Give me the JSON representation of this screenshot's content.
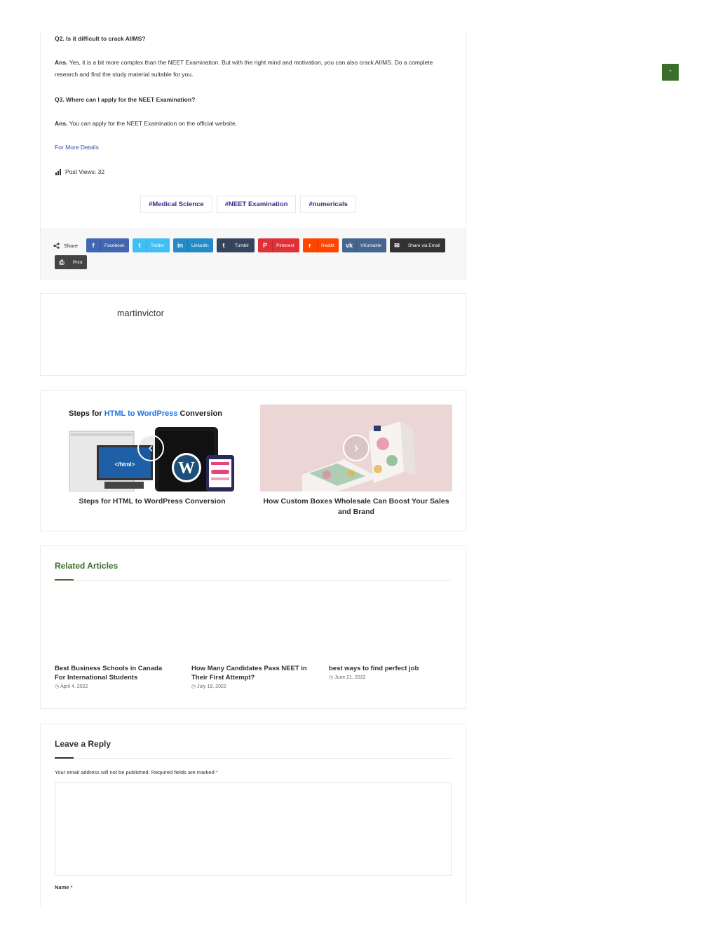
{
  "faq": [
    {
      "question": "Q2. Is it difficult to crack AIIMS?",
      "answer_label": "Ans.",
      "answer": " Yes, it is a bit more complex than the NEET Examination. But with the right mind and motivation, you can also crack AIIMS. Do a complete research and find the study material suitable for you."
    },
    {
      "question": "Q3. Where can I apply for the NEET Examination?",
      "answer_label": "Ans.",
      "answer": " You can apply for the NEET Examination on the official website."
    }
  ],
  "more_link": "For More Details",
  "post_views": "Post Views: 32",
  "tags": [
    "#Medical Science",
    "#NEET Examination",
    "#numericals"
  ],
  "share": {
    "label": "Share",
    "buttons": [
      {
        "label": "Facebook",
        "icon": "facebook-icon",
        "glyph": "f",
        "color": "#4267b2"
      },
      {
        "label": "Twitter",
        "icon": "twitter-icon",
        "glyph": "t",
        "color": "#40bff5"
      },
      {
        "label": "LinkedIn",
        "icon": "linkedin-icon",
        "glyph": "in",
        "color": "#238cc8"
      },
      {
        "label": "Tumblr",
        "icon": "tumblr-icon",
        "glyph": "t",
        "color": "#35465c"
      },
      {
        "label": "Pinterest",
        "icon": "pinterest-icon",
        "glyph": "P",
        "color": "#e13138"
      },
      {
        "label": "Reddit",
        "icon": "reddit-icon",
        "glyph": "r",
        "color": "#ff4500"
      },
      {
        "label": "VKontakte",
        "icon": "vk-icon",
        "glyph": "vk",
        "color": "#45668e"
      },
      {
        "label": "Share via Email",
        "icon": "email-icon",
        "glyph": "✉",
        "color": "#333333"
      },
      {
        "label": "Print",
        "icon": "print-icon",
        "glyph": "⎙",
        "color": "#444444"
      }
    ]
  },
  "author": {
    "name": "martinvictor"
  },
  "post_nav": {
    "prev": {
      "title": "Steps for HTML to WordPress Conversion",
      "image_heading_pre": "Steps for ",
      "image_heading_accent": "HTML to WordPress",
      "image_heading_post": " Conversion",
      "html_tag_text": "</html>"
    },
    "next": {
      "title": "How Custom Boxes Wholesale Can Boost Your Sales and Brand"
    }
  },
  "related": {
    "title": "Related Articles",
    "items": [
      {
        "title": "Best Business Schools in Canada For International Students",
        "date": "April 4, 2022"
      },
      {
        "title": " How Many Candidates Pass NEET in Their First Attempt?",
        "date": "July 19, 2022"
      },
      {
        "title": "best ways to find perfect job",
        "date": "June 21, 2022"
      }
    ]
  },
  "reply": {
    "title": "Leave a Reply",
    "note": "Your email address will not be published. Required fields are marked ",
    "required_mark": "*",
    "name_label": "Name ",
    "name_required": "*"
  },
  "colors": {
    "accent_green": "#3a6e2a",
    "link_blue": "#3b4a9c",
    "tag_purple": "#3b2a8a",
    "accent_blue": "#1a73e8"
  }
}
